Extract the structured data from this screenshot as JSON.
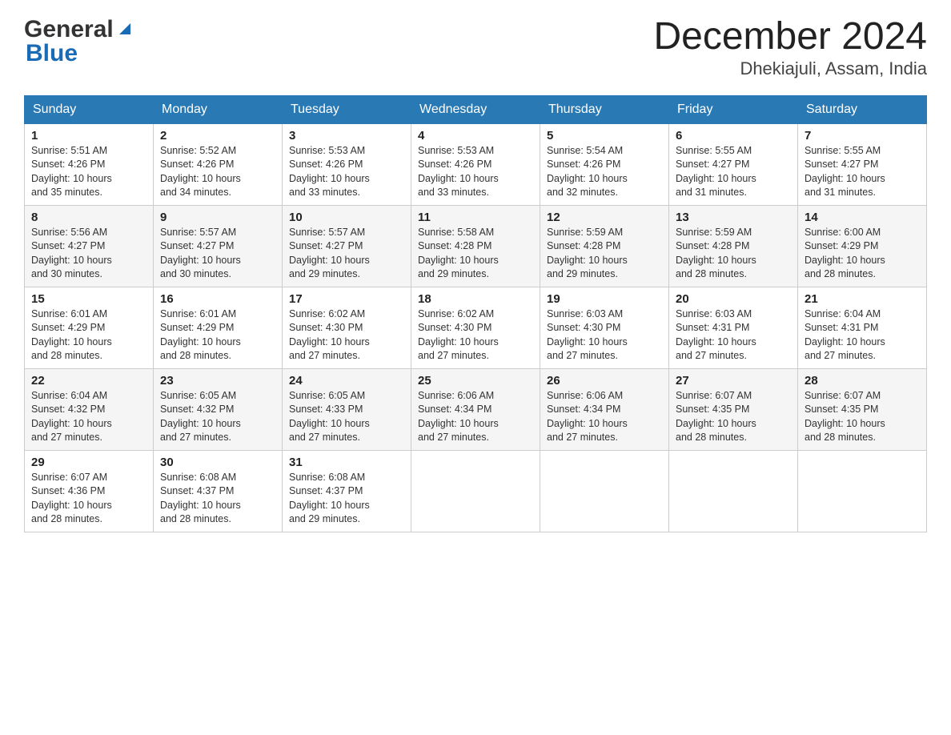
{
  "header": {
    "logo_general": "General",
    "logo_blue": "Blue",
    "month_title": "December 2024",
    "location": "Dhekiajuli, Assam, India"
  },
  "weekdays": [
    "Sunday",
    "Monday",
    "Tuesday",
    "Wednesday",
    "Thursday",
    "Friday",
    "Saturday"
  ],
  "weeks": [
    [
      {
        "day": "1",
        "sunrise": "5:51 AM",
        "sunset": "4:26 PM",
        "daylight": "10 hours and 35 minutes."
      },
      {
        "day": "2",
        "sunrise": "5:52 AM",
        "sunset": "4:26 PM",
        "daylight": "10 hours and 34 minutes."
      },
      {
        "day": "3",
        "sunrise": "5:53 AM",
        "sunset": "4:26 PM",
        "daylight": "10 hours and 33 minutes."
      },
      {
        "day": "4",
        "sunrise": "5:53 AM",
        "sunset": "4:26 PM",
        "daylight": "10 hours and 33 minutes."
      },
      {
        "day": "5",
        "sunrise": "5:54 AM",
        "sunset": "4:26 PM",
        "daylight": "10 hours and 32 minutes."
      },
      {
        "day": "6",
        "sunrise": "5:55 AM",
        "sunset": "4:27 PM",
        "daylight": "10 hours and 31 minutes."
      },
      {
        "day": "7",
        "sunrise": "5:55 AM",
        "sunset": "4:27 PM",
        "daylight": "10 hours and 31 minutes."
      }
    ],
    [
      {
        "day": "8",
        "sunrise": "5:56 AM",
        "sunset": "4:27 PM",
        "daylight": "10 hours and 30 minutes."
      },
      {
        "day": "9",
        "sunrise": "5:57 AM",
        "sunset": "4:27 PM",
        "daylight": "10 hours and 30 minutes."
      },
      {
        "day": "10",
        "sunrise": "5:57 AM",
        "sunset": "4:27 PM",
        "daylight": "10 hours and 29 minutes."
      },
      {
        "day": "11",
        "sunrise": "5:58 AM",
        "sunset": "4:28 PM",
        "daylight": "10 hours and 29 minutes."
      },
      {
        "day": "12",
        "sunrise": "5:59 AM",
        "sunset": "4:28 PM",
        "daylight": "10 hours and 29 minutes."
      },
      {
        "day": "13",
        "sunrise": "5:59 AM",
        "sunset": "4:28 PM",
        "daylight": "10 hours and 28 minutes."
      },
      {
        "day": "14",
        "sunrise": "6:00 AM",
        "sunset": "4:29 PM",
        "daylight": "10 hours and 28 minutes."
      }
    ],
    [
      {
        "day": "15",
        "sunrise": "6:01 AM",
        "sunset": "4:29 PM",
        "daylight": "10 hours and 28 minutes."
      },
      {
        "day": "16",
        "sunrise": "6:01 AM",
        "sunset": "4:29 PM",
        "daylight": "10 hours and 28 minutes."
      },
      {
        "day": "17",
        "sunrise": "6:02 AM",
        "sunset": "4:30 PM",
        "daylight": "10 hours and 27 minutes."
      },
      {
        "day": "18",
        "sunrise": "6:02 AM",
        "sunset": "4:30 PM",
        "daylight": "10 hours and 27 minutes."
      },
      {
        "day": "19",
        "sunrise": "6:03 AM",
        "sunset": "4:30 PM",
        "daylight": "10 hours and 27 minutes."
      },
      {
        "day": "20",
        "sunrise": "6:03 AM",
        "sunset": "4:31 PM",
        "daylight": "10 hours and 27 minutes."
      },
      {
        "day": "21",
        "sunrise": "6:04 AM",
        "sunset": "4:31 PM",
        "daylight": "10 hours and 27 minutes."
      }
    ],
    [
      {
        "day": "22",
        "sunrise": "6:04 AM",
        "sunset": "4:32 PM",
        "daylight": "10 hours and 27 minutes."
      },
      {
        "day": "23",
        "sunrise": "6:05 AM",
        "sunset": "4:32 PM",
        "daylight": "10 hours and 27 minutes."
      },
      {
        "day": "24",
        "sunrise": "6:05 AM",
        "sunset": "4:33 PM",
        "daylight": "10 hours and 27 minutes."
      },
      {
        "day": "25",
        "sunrise": "6:06 AM",
        "sunset": "4:34 PM",
        "daylight": "10 hours and 27 minutes."
      },
      {
        "day": "26",
        "sunrise": "6:06 AM",
        "sunset": "4:34 PM",
        "daylight": "10 hours and 27 minutes."
      },
      {
        "day": "27",
        "sunrise": "6:07 AM",
        "sunset": "4:35 PM",
        "daylight": "10 hours and 28 minutes."
      },
      {
        "day": "28",
        "sunrise": "6:07 AM",
        "sunset": "4:35 PM",
        "daylight": "10 hours and 28 minutes."
      }
    ],
    [
      {
        "day": "29",
        "sunrise": "6:07 AM",
        "sunset": "4:36 PM",
        "daylight": "10 hours and 28 minutes."
      },
      {
        "day": "30",
        "sunrise": "6:08 AM",
        "sunset": "4:37 PM",
        "daylight": "10 hours and 28 minutes."
      },
      {
        "day": "31",
        "sunrise": "6:08 AM",
        "sunset": "4:37 PM",
        "daylight": "10 hours and 29 minutes."
      },
      null,
      null,
      null,
      null
    ]
  ],
  "labels": {
    "sunrise": "Sunrise:",
    "sunset": "Sunset:",
    "daylight": "Daylight:"
  }
}
